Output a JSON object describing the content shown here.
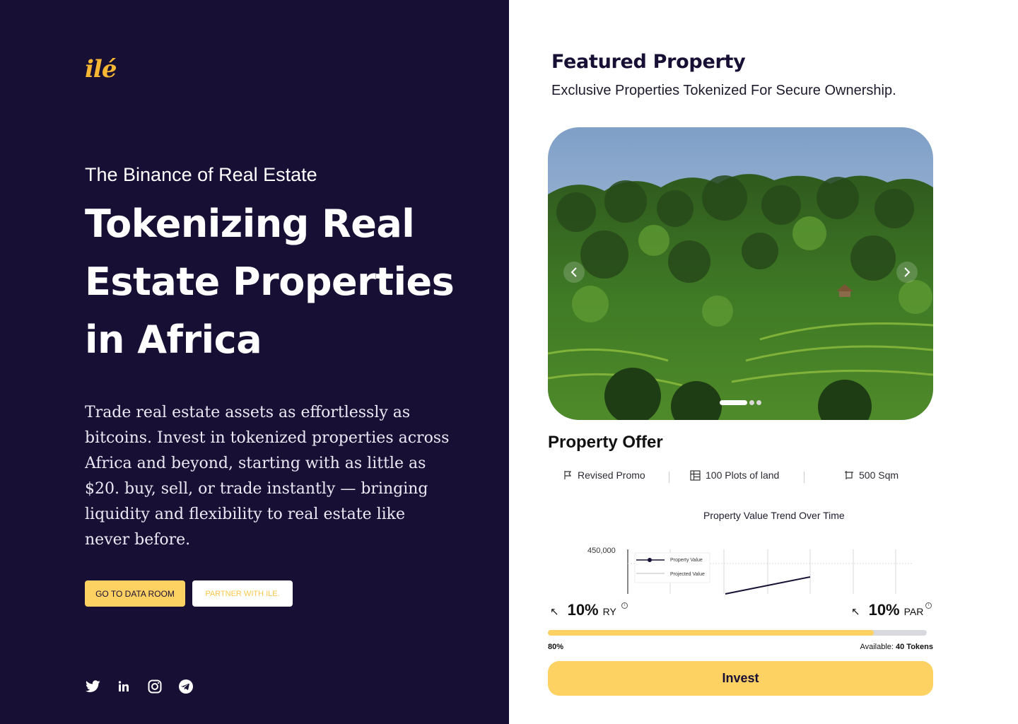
{
  "brand": {
    "logo_text": "ilé",
    "logo_color": "#f7b733"
  },
  "hero": {
    "tagline": "The Binance of Real Estate",
    "headline": "Tokenizing Real Estate Properties in Africa",
    "description": "Trade real estate assets as effortlessly as bitcoins. Invest in tokenized properties across Africa and beyond, starting with as little as $20. buy, sell, or trade instantly — bringing liquidity and flexibility to real estate like never before.",
    "buttons": {
      "primary": "GO TO DATA ROOM",
      "secondary": "PARTNER  WITH ILE."
    }
  },
  "socials": [
    "twitter-icon",
    "linkedin-icon",
    "instagram-icon",
    "telegram-icon"
  ],
  "featured": {
    "title": "Featured Property",
    "subtitle": "Exclusive Properties Tokenized For Secure Ownership.",
    "carousel": {
      "slides": 3,
      "active_slide": 1
    }
  },
  "offer": {
    "title": "Property Offer",
    "features": [
      {
        "icon": "flag-icon",
        "label": "Revised Promo"
      },
      {
        "icon": "grid-icon",
        "label": "100 Plots of land"
      },
      {
        "icon": "area-icon",
        "label": "500 Sqm"
      }
    ]
  },
  "chart_data": {
    "type": "line",
    "title": "Property Value Trend Over Time",
    "yticks": [
      "450,000"
    ],
    "series": [
      {
        "name": "Property Value"
      },
      {
        "name": "Projected Value"
      }
    ]
  },
  "stats": {
    "ry": {
      "value": "10%",
      "label": "RY"
    },
    "par": {
      "value": "10%",
      "label": "PAR"
    }
  },
  "progress": {
    "percent_label": "80%",
    "fraction": 0.86,
    "available_label": "Available:",
    "available_value": "40 Tokens"
  },
  "invest_label": "Invest",
  "colors": {
    "navy": "#180f35",
    "accent": "#fdd162"
  }
}
